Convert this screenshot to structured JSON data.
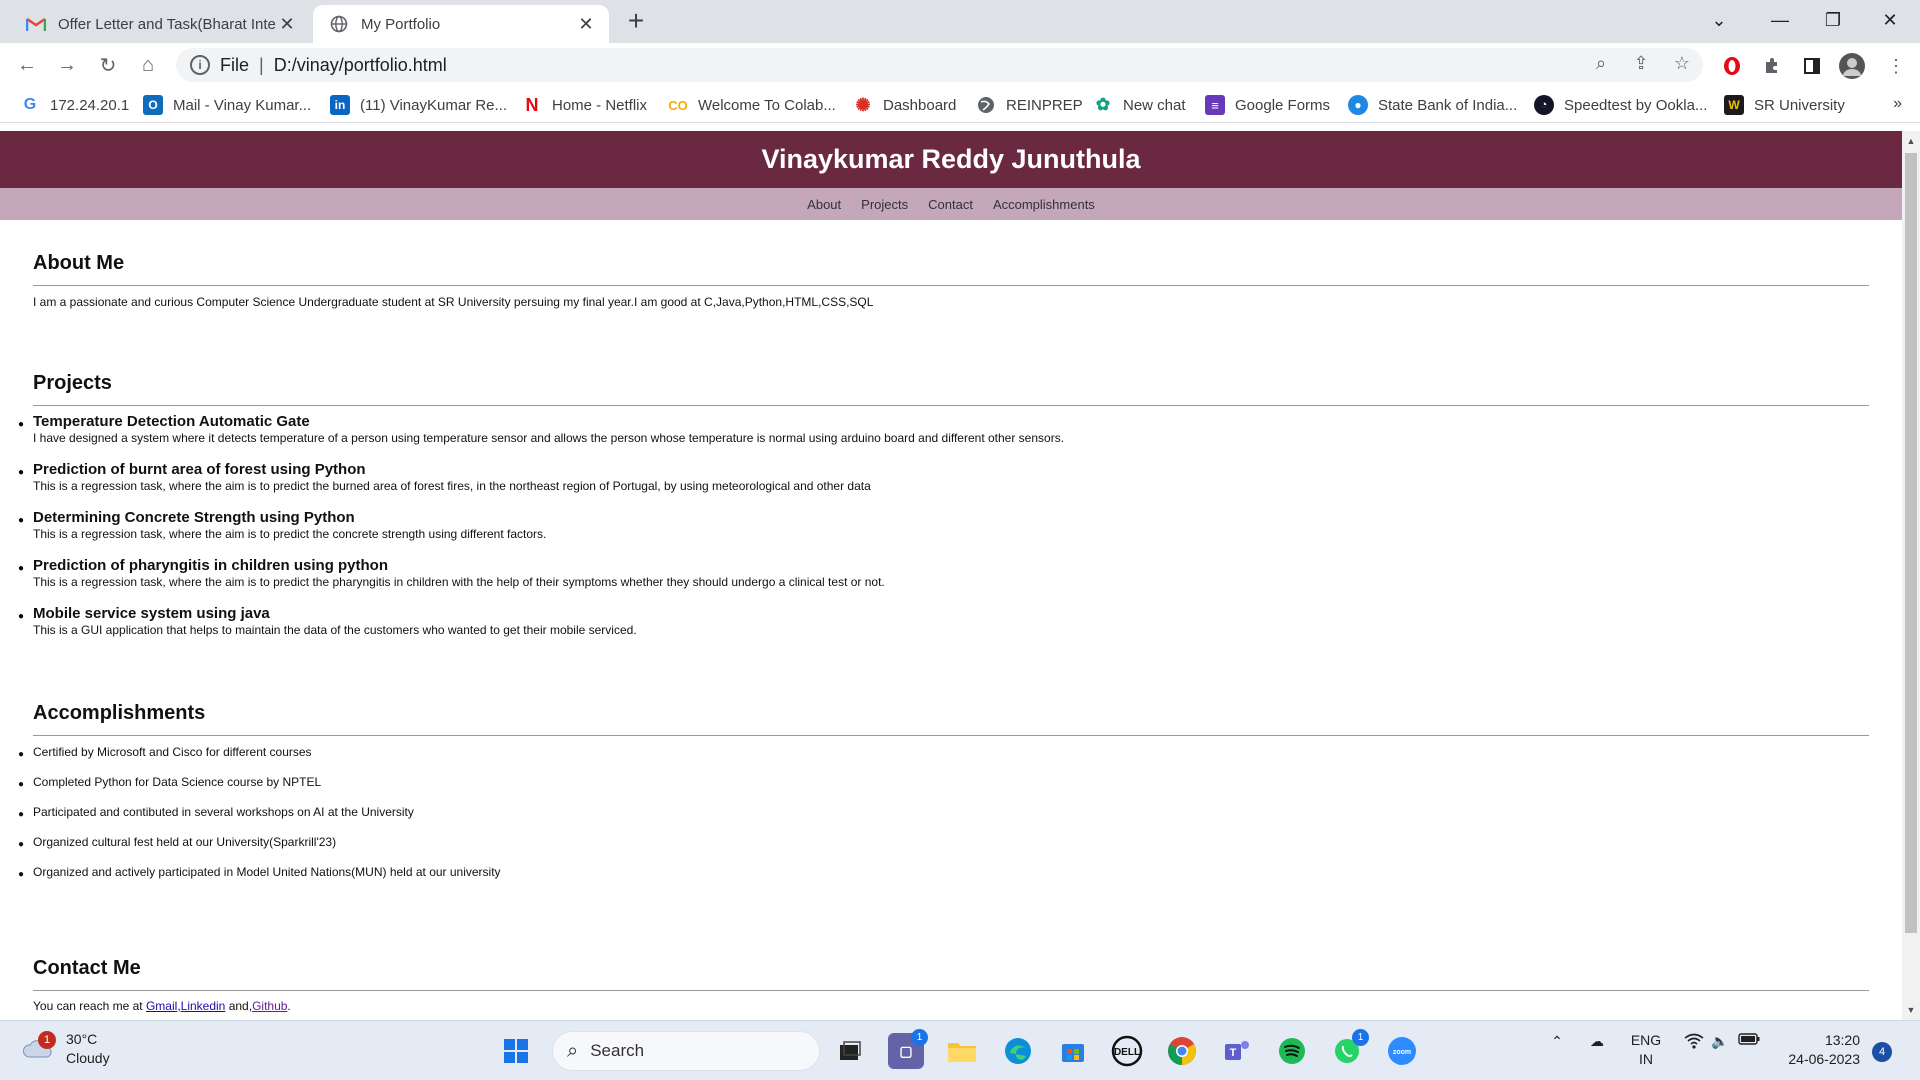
{
  "browser": {
    "tabs": [
      {
        "title": "Offer Letter and Task(Bharat Inter",
        "icon": "gmail-icon"
      },
      {
        "title": "My Portfolio",
        "icon": "globe-icon"
      }
    ],
    "address": {
      "scheme": "File",
      "url": "D:/vinay/portfolio.html"
    },
    "bookmarks": [
      {
        "label": "172.24.20.1",
        "icon": "google-icon"
      },
      {
        "label": "Mail - Vinay Kumar...",
        "icon": "outlook-icon"
      },
      {
        "label": "(11) VinayKumar Re...",
        "icon": "linkedin-icon"
      },
      {
        "label": "Home - Netflix",
        "icon": "netflix-icon"
      },
      {
        "label": "Welcome To Colab...",
        "icon": "colab-icon"
      },
      {
        "label": "Dashboard",
        "icon": "dashboard-icon"
      },
      {
        "label": "REINPREP",
        "icon": "globe-icon"
      },
      {
        "label": "New chat",
        "icon": "chatgpt-icon"
      },
      {
        "label": "Google Forms",
        "icon": "forms-icon"
      },
      {
        "label": "State Bank of India...",
        "icon": "sbi-icon"
      },
      {
        "label": "Speedtest by Ookla...",
        "icon": "speedtest-icon"
      },
      {
        "label": "SR University",
        "icon": "sru-icon"
      }
    ],
    "bookmarks_more": "»"
  },
  "page": {
    "header_title": "Vinaykumar Reddy Junuthula",
    "nav": [
      "About",
      "Projects",
      "Contact",
      "Accomplishments"
    ],
    "about": {
      "heading": "About Me",
      "text": "I am a passionate and curious Computer Science Undergraduate student at SR University persuing my final year.I am good at C,Java,Python,HTML,CSS,SQL"
    },
    "projects": {
      "heading": "Projects",
      "items": [
        {
          "title": "Temperature Detection Automatic Gate",
          "desc": "I have designed a system where it detects temperature of a person using temperature sensor and allows the person whose temperature is normal using arduino board and different other sensors."
        },
        {
          "title": "Prediction of burnt area of forest using Python",
          "desc": "This is a regression task, where the aim is to predict the burned area of forest fires, in the northeast region of Portugal, by using meteorological and other data"
        },
        {
          "title": "Determining Concrete Strength using Python",
          "desc": "This is a regression task, where the aim is to predict the concrete strength using different factors."
        },
        {
          "title": "Prediction of pharyngitis in children using python",
          "desc": "This is a regression task, where the aim is to predict the pharyngitis in children with the help of their symptoms whether they should undergo a clinical test or not."
        },
        {
          "title": "Mobile service system using java",
          "desc": "This is a GUI application that helps to maintain the data of the customers who wanted to get their mobile serviced."
        }
      ]
    },
    "accomplishments": {
      "heading": "Accomplishments",
      "items": [
        "Certified by Microsoft and Cisco for different courses",
        "Completed Python for Data Science course by NPTEL",
        "Participated and contibuted in several workshops on AI at the University",
        "Organized cultural fest held at our University(Sparkrill'23)",
        "Organized and actively participated in Model United Nations(MUN) held at our university"
      ]
    },
    "contact": {
      "heading": "Contact Me",
      "prefix": "You can reach me at ",
      "links": [
        "Gmail",
        "Linkedin",
        "Github"
      ],
      "sep1": ",",
      "sep2": " and,",
      "suffix": "."
    }
  },
  "taskbar": {
    "weather_temp": "30°C",
    "weather_desc": "Cloudy",
    "weather_badge": "1",
    "search_placeholder": "Search",
    "teams_badge": "1",
    "whatsapp_badge": "1",
    "lang_1": "ENG",
    "lang_2": "IN",
    "time": "13:20",
    "date": "24-06-2023",
    "notifications": "4"
  },
  "colors": {
    "header": "#6a2841",
    "nav": "#c4a7b9",
    "link": "#1a0dab"
  }
}
